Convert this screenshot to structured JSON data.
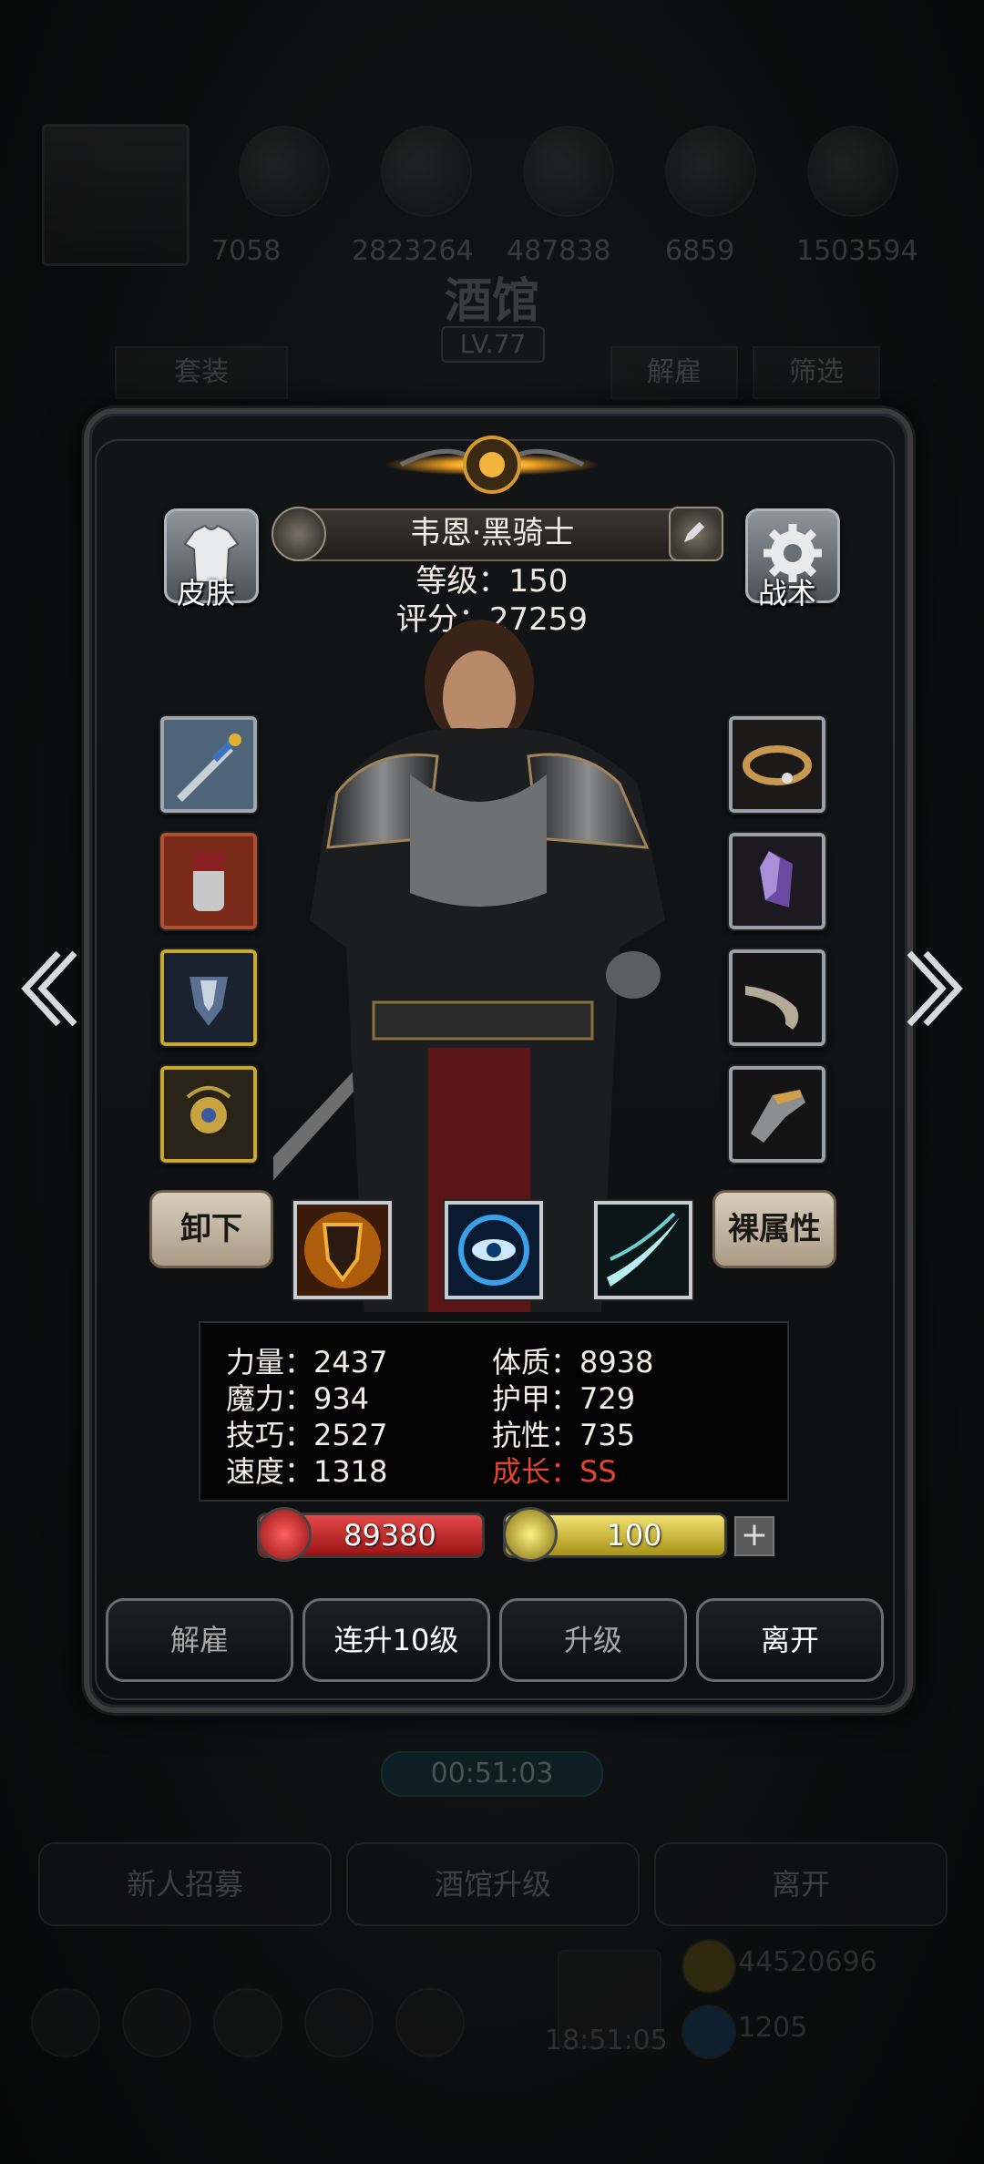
{
  "background": {
    "title": "酒馆",
    "level": "LV.77",
    "resources": [
      "7058",
      "2823264",
      "487838",
      "6859",
      "1503594"
    ],
    "tabs": {
      "left": "套装",
      "dismiss": "解雇",
      "filter": "筛选"
    },
    "timer": "00:51:03",
    "buttons": {
      "recruit": "新人招募",
      "upgrade_tavern": "酒馆升级",
      "leave": "离开"
    },
    "bottom": {
      "clock": "18:51:05",
      "gold": "44520696",
      "gems": "1205"
    }
  },
  "hero": {
    "name": "韦恩·黑骑士",
    "level_label": "等级：",
    "level_value": "150",
    "score_label": "评分：",
    "score_value": "27259"
  },
  "side_buttons": {
    "skin": "皮肤",
    "tactics": "战术"
  },
  "equipment_left": [
    "sword-icon",
    "chest-armor-icon",
    "pauldron-icon",
    "amulet-icon"
  ],
  "equipment_right": [
    "ring-icon",
    "gem-icon",
    "horn-icon",
    "gauntlet-icon"
  ],
  "actions": {
    "unequip": "卸下",
    "base_attributes": "裸属性"
  },
  "skills": [
    "shield-skill-icon",
    "eye-skill-icon",
    "slash-skill-icon"
  ],
  "stats": {
    "strength": "力量：2437",
    "constitution": "体质：8938",
    "magic": "魔力：934",
    "armor": "护甲：729",
    "skill": "技巧：2527",
    "resistance": "抗性：735",
    "speed": "速度：1318",
    "growth": "成长：SS"
  },
  "hp": "89380",
  "energy": "100",
  "plus": "+",
  "dialog_buttons": {
    "dismiss": "解雇",
    "level_up_10": "连升10级",
    "upgrade": "升级",
    "leave": "离开"
  },
  "colors": {
    "growth": "#e0452e",
    "hp": "#c82020",
    "energy": "#d4c030"
  }
}
